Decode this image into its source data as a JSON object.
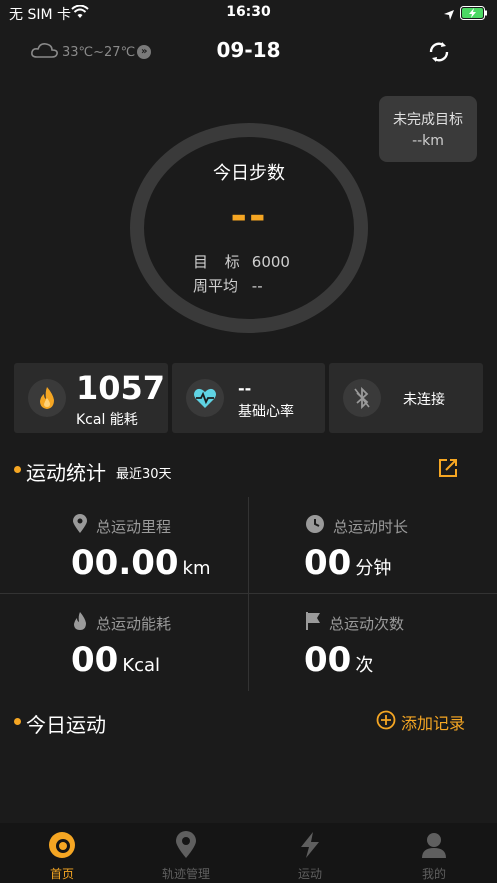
{
  "status_bar": {
    "carrier": "无 SIM 卡",
    "time": "16:30"
  },
  "header": {
    "weather": "33℃~27℃",
    "date": "09-18"
  },
  "steps": {
    "title": "今日步数",
    "value": "--",
    "goal_label": "目 标",
    "goal_value": "6000",
    "avg_label": "周平均",
    "avg_value": "--"
  },
  "goal_bubble": {
    "title": "未完成目标",
    "value": "--km"
  },
  "cards": {
    "calories": {
      "value": "1057",
      "label": "Kcal 能耗"
    },
    "heart_rate": {
      "value": "--",
      "label": "基础心率"
    },
    "device": {
      "label": "未连接"
    }
  },
  "stats_section": {
    "title": "运动统计",
    "subtitle": "最近30天"
  },
  "stats": {
    "distance": {
      "label": "总运动里程",
      "value": "00.00",
      "unit": "km"
    },
    "duration": {
      "label": "总运动时长",
      "value": "00",
      "unit": "分钟"
    },
    "energy": {
      "label": "总运动能耗",
      "value": "00",
      "unit": "Kcal"
    },
    "count": {
      "label": "总运动次数",
      "value": "00",
      "unit": "次"
    }
  },
  "today_section": {
    "title": "今日运动",
    "add_label": "添加记录"
  },
  "tabs": [
    {
      "label": "首页",
      "icon": "home-icon",
      "active": true
    },
    {
      "label": "轨迹管理",
      "icon": "location-icon",
      "active": false
    },
    {
      "label": "运动",
      "icon": "lightning-icon",
      "active": false
    },
    {
      "label": "我的",
      "icon": "user-icon",
      "active": false
    }
  ],
  "colors": {
    "accent": "#f5a623",
    "background": "#1b1b1b",
    "card": "#2b2b2b"
  }
}
